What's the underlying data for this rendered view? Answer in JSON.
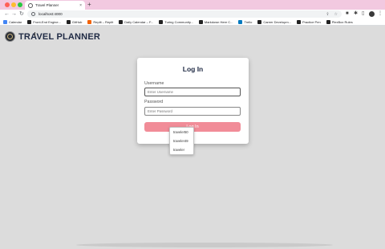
{
  "browser": {
    "tab_title": "Travel Planner",
    "tab_close": "×",
    "new_tab": "+",
    "url": "localhost:4000",
    "bookmarks": [
      {
        "label": "Calendar",
        "color": "#4285f4"
      },
      {
        "label": "Front-End Engine...",
        "color": "#222222"
      },
      {
        "label": "GitHub",
        "color": "#222222"
      },
      {
        "label": "Replit – Replit",
        "color": "#f26207"
      },
      {
        "label": "Daily Calendar – F...",
        "color": "#222222"
      },
      {
        "label": "Turing Community...",
        "color": "#222222"
      },
      {
        "label": "Markdown Here C...",
        "color": "#222222"
      },
      {
        "label": "Trello",
        "color": "#0079bf"
      },
      {
        "label": "Career Developm...",
        "color": "#222222"
      },
      {
        "label": "Practice Pen",
        "color": "#222222"
      },
      {
        "label": "PlexBox Rules",
        "color": "#222222"
      }
    ]
  },
  "app": {
    "brand": "TRAVEL PLANNER"
  },
  "login": {
    "title": "Log In",
    "username_label": "Username",
    "username_placeholder": "Enter Username",
    "password_label": "Password",
    "password_placeholder": "Enter Password",
    "button_label": "Log In"
  },
  "autocomplete": {
    "options": [
      "traveler50",
      "traveler49",
      "traveler"
    ]
  },
  "colors": {
    "accent": "#f18c98",
    "brand": "#1f2a44",
    "background": "#dcdcdc"
  }
}
